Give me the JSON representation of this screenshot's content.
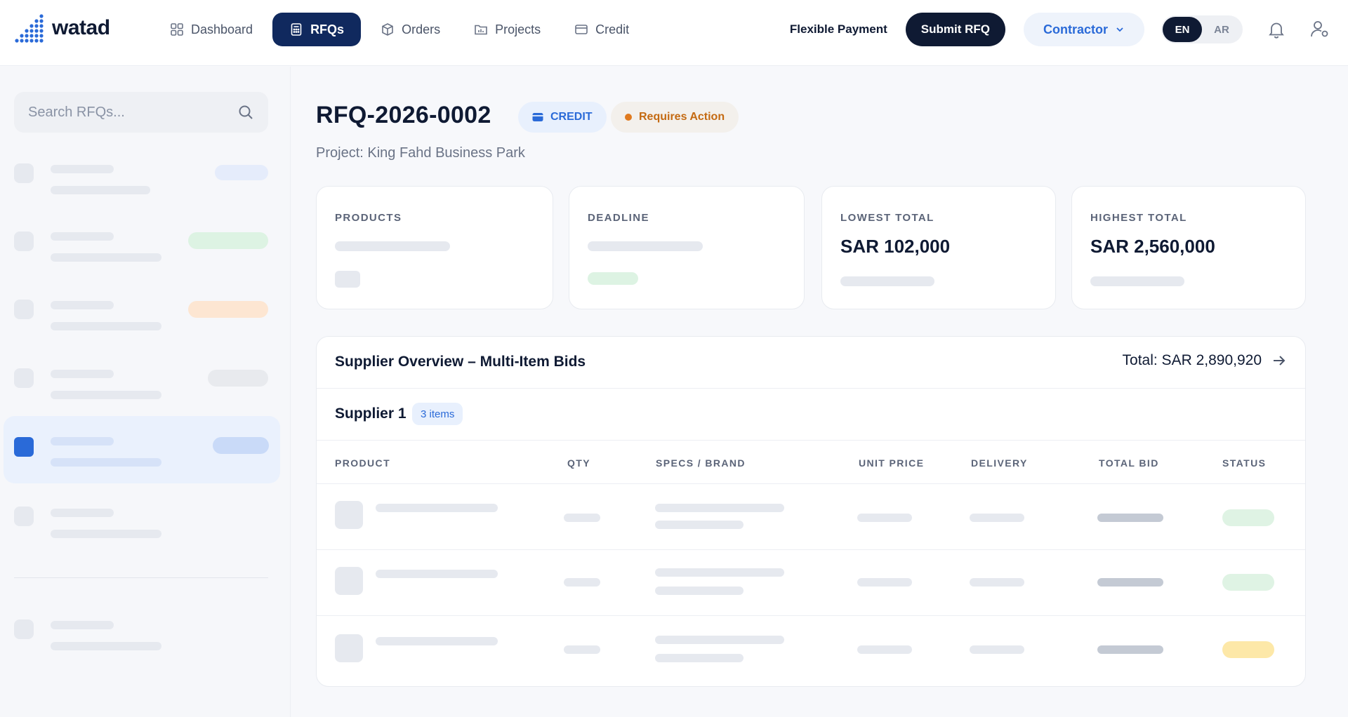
{
  "brand": {
    "name": "watad"
  },
  "nav": {
    "items": [
      {
        "label": "Dashboard",
        "icon": "grid-icon",
        "active": false
      },
      {
        "label": "RFQs",
        "icon": "calculator-icon",
        "active": true
      },
      {
        "label": "Orders",
        "icon": "box-icon",
        "active": false
      },
      {
        "label": "Projects",
        "icon": "chart-folder-icon",
        "active": false
      },
      {
        "label": "Credit",
        "icon": "card-icon",
        "active": false
      }
    ]
  },
  "header": {
    "flexible_payment": "Flexible Payment",
    "submit_rfq": "Submit RFQ",
    "role": "Contractor",
    "lang_en": "EN",
    "lang_ar": "AR"
  },
  "sidebar": {
    "search_placeholder": "Search RFQs..."
  },
  "rfq": {
    "id": "RFQ-2026-0002",
    "type_badge": "CREDIT",
    "status_badge": "Requires Action",
    "project": "Project: King Fahd Business Park"
  },
  "stats": {
    "products_label": "PRODUCTS",
    "deadline_label": "DEADLINE",
    "lowest_label": "LOWEST TOTAL",
    "lowest_value": "SAR 102,000",
    "highest_label": "HIGHEST TOTAL",
    "highest_value": "SAR 2,560,000"
  },
  "overview": {
    "title": "Supplier Overview – Multi-Item Bids",
    "total": "Total: SAR 2,890,920",
    "supplier_name": "Supplier 1",
    "items_count": "3 items",
    "columns": [
      "PRODUCT",
      "QTY",
      "SPECS / BRAND",
      "UNIT PRICE",
      "DELIVERY",
      "TOTAL BID",
      "STATUS"
    ]
  },
  "colors": {
    "primary": "#10295e",
    "accent_blue": "#2a6ad8",
    "warning": "#e07a1f",
    "status_green": "#dff3e4",
    "status_yellow": "#fde8a8"
  }
}
